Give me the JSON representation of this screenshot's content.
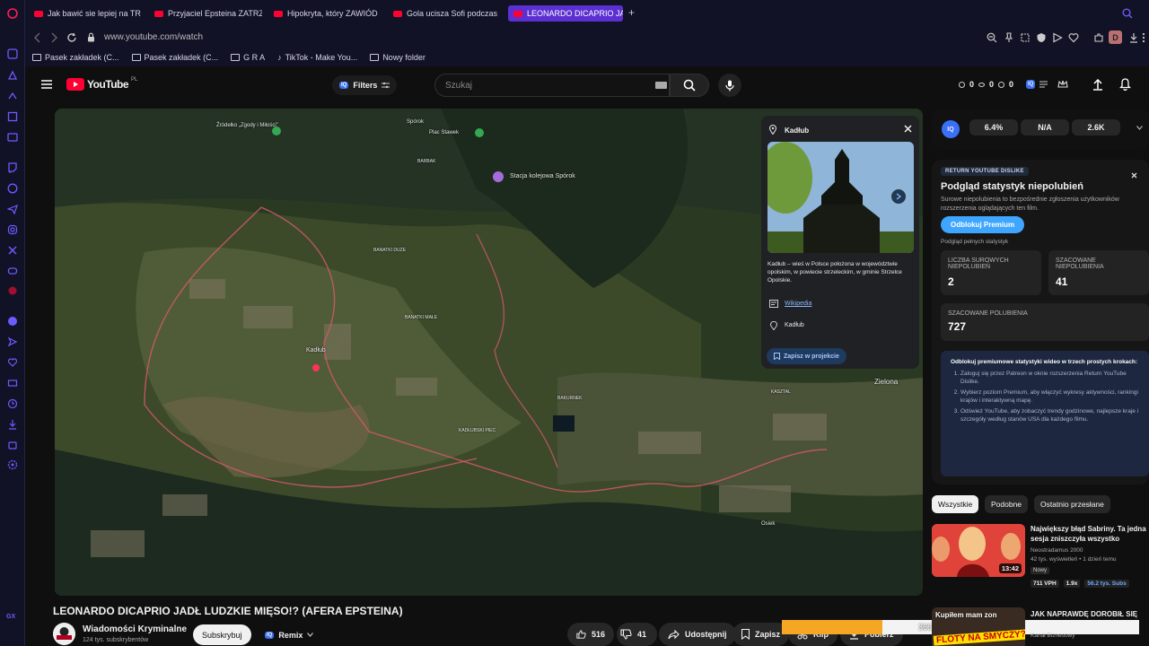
{
  "browser": {
    "tabs": [
      {
        "label": "Jak bawić sie lepiej na TR",
        "active": false
      },
      {
        "label": "Przyjaciel Epsteina ZATRZ",
        "active": false
      },
      {
        "label": "Hipokryta, który ZAWIÓD",
        "active": false
      },
      {
        "label": "Gola ucisza Sofi podczas",
        "active": false
      },
      {
        "label": "LEONARDO DICAPRIO JAD",
        "active": true
      }
    ],
    "url": "www.youtube.com/watch",
    "profile_initial": "D",
    "bookmarks": [
      "Pasek zakładek (C...",
      "Pasek zakładek (C...",
      "G R A",
      "TikTok - Make You...",
      "Nowy folder"
    ],
    "sidebar_bottom_label": "GX"
  },
  "youtube": {
    "logo_text": "YouTube",
    "logo_region": "PL",
    "filters_label": "Filters",
    "filters_badge": "IQ",
    "search_placeholder": "Szukaj",
    "counters": [
      "0",
      "0",
      "0"
    ],
    "counter_badge": "IQ"
  },
  "map": {
    "labels": [
      {
        "text": "Źródełko „Zgody i Miłości”"
      },
      {
        "text": "Spórok"
      },
      {
        "text": "Plac Stawek"
      },
      {
        "text": "BARBAK"
      },
      {
        "text": "Stacja kolejowa Spórok"
      },
      {
        "text": "BANATKI DUŻE"
      },
      {
        "text": "BANATKI MAŁE"
      },
      {
        "text": "Kadłub"
      },
      {
        "text": "BAKURNEK"
      },
      {
        "text": "KADŁUBSKI PIEC"
      },
      {
        "text": "KASZTAL"
      },
      {
        "text": "Zielona"
      },
      {
        "text": "Osiek"
      }
    ]
  },
  "infocard": {
    "title": "Kadłub",
    "description": "Kadłub – wieś w Polsce położona w województwie opolskim, w powiecie strzeleckim, w gminie Strzelce Opolskie.",
    "link_label": "Wikipedia",
    "place_label": "Kadłub",
    "save_label": "Zapisz w projekcie"
  },
  "video": {
    "title": "LEONARDO DICAPRIO JADŁ LUDZKIE MIĘSO!? (AFERA EPSTEINA)",
    "channel": "Wiadomości Kryminalne",
    "subscribers": "124 tys. subskrybentów",
    "subscribe_label": "Subskrybuj",
    "remix_label": "Remix",
    "remix_badge": "IQ",
    "likes": "516",
    "dislikes": "41",
    "share_label": "Udostępnij",
    "save_label": "Zapisz",
    "clip_label": "Klip",
    "download_label": "Pobierz",
    "download_progress_text": "366.00 / 1300 (28.08%)",
    "download_progress": 0.2808
  },
  "iq_bar": {
    "badge": "IQ",
    "values": [
      "6.4%",
      "N/A",
      "2.6K"
    ]
  },
  "ryd": {
    "tag": "RETURN YOUTUBE DISLIKE",
    "title": "Podgląd statystyk niepolubień",
    "subtitle": "Surowe niepolubienia to bezpośrednie zgłoszenia użytkowników rozszerzenia oglądających ten film.",
    "premium_button": "Odblokuj Premium",
    "full_stats_label": "Podgląd pełnych statystyk",
    "raw_dislikes_label": "LICZBA SUROWYCH NIEPOLUBIEŃ",
    "raw_dislikes": "2",
    "est_dislikes_label": "SZACOWANE NIEPOLUBIENIA",
    "est_dislikes": "41",
    "est_likes_label": "SZACOWANE POLUBIENIA",
    "est_likes": "727",
    "premium_box_title": "Odblokuj premiumowe statystyki wideo w trzech prostych krokach:",
    "steps": [
      "Zaloguj się przez Patreon w oknie rozszerzenia Return YouTube Dislike.",
      "Wybierz poziom Premium, aby włączyć wykresy aktywności, rankingi krajów i interaktywną mapę.",
      "Odśwież YouTube, aby zobaczyć trendy godzinowe, najlepsze kraje i szczegóły według stanów USA dla każdego filmu."
    ]
  },
  "recommendations": {
    "chips": [
      "Wszystkie",
      "Podobne",
      "Ostatnio przesłane"
    ],
    "items": [
      {
        "title": "Największy błąd Sabriny. Ta jedna sesja zniszczyła wszystko",
        "channel": "Neostradamus 2000",
        "meta": "42 tys. wyświetleń • 1 dzień temu",
        "badge": "Nowy",
        "duration": "13:42",
        "stat1": "711 VPH",
        "stat2": "1.9x",
        "stat3": "56.2 tys. Subs"
      },
      {
        "title": "JAK NAPRAWDĘ DOROBIŁ SIĘ",
        "channel": "Kanał Biznesowy",
        "overlay_line1": "Kupiłem mam zon",
        "overlay_line2": "FLOTY NA SMYCZY?"
      }
    ]
  },
  "colors": {
    "accent_purple": "#5b2fd1",
    "youtube_red": "#ff0033",
    "iq_blue": "#3a6ff7",
    "ryd_blue": "#3ea6ff",
    "download_orange": "#f5a623"
  }
}
